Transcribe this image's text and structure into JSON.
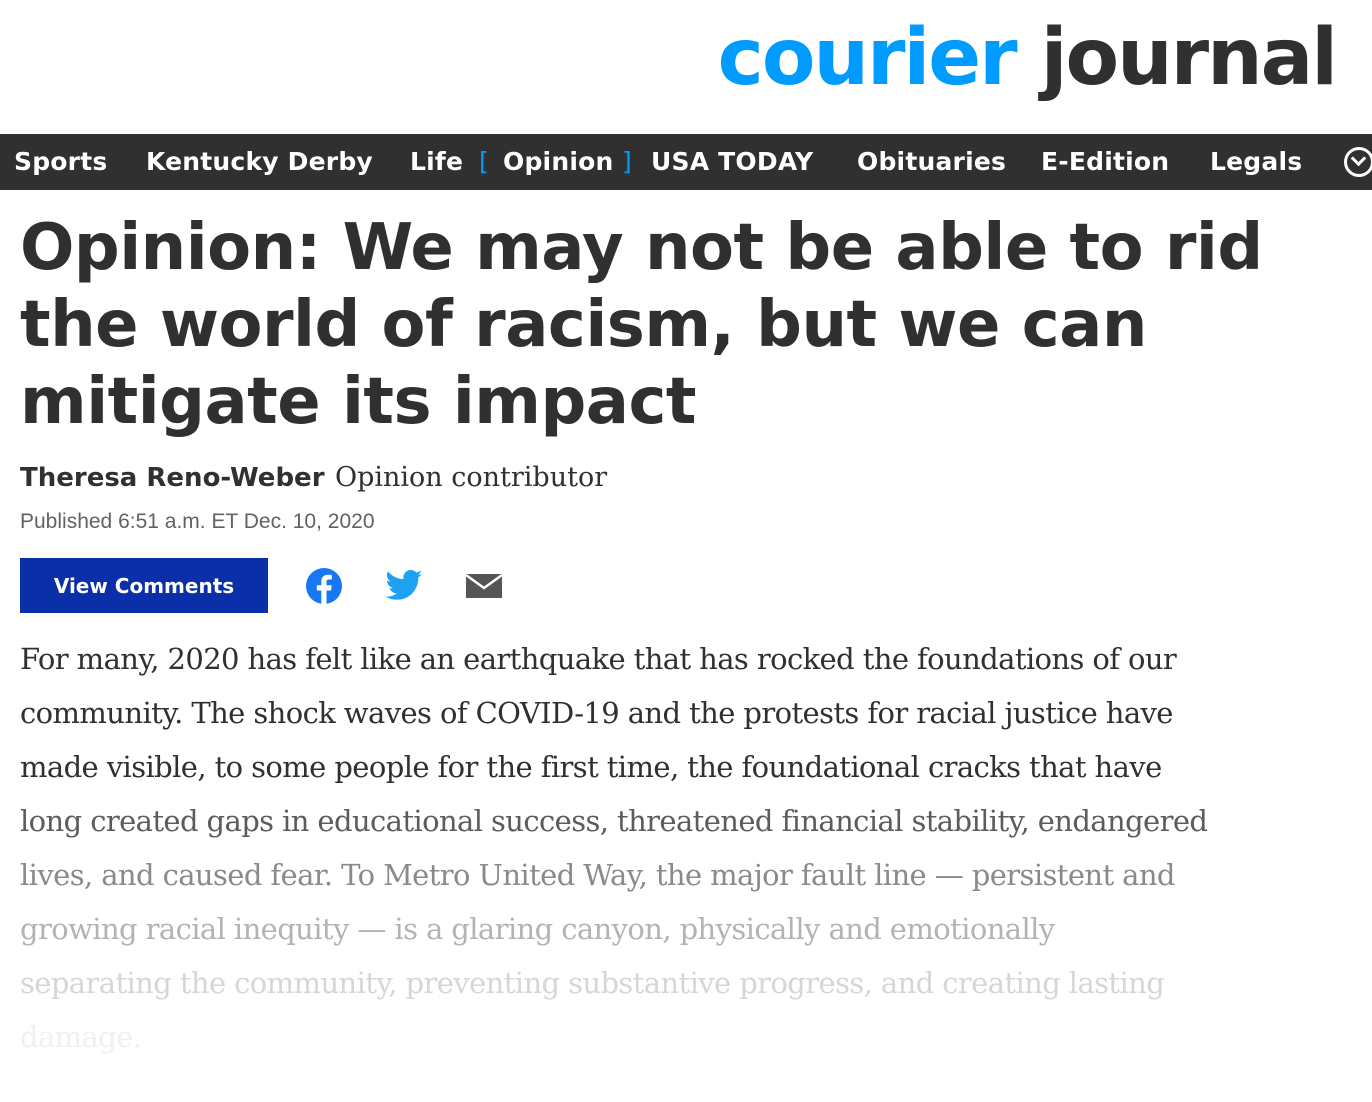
{
  "site": {
    "logo_part1": "courier",
    "logo_part2": "journal"
  },
  "nav": {
    "items": [
      {
        "label": "Sports"
      },
      {
        "label": "Kentucky Derby"
      },
      {
        "label": "Life"
      },
      {
        "label": "Opinion",
        "active": true
      },
      {
        "label": "USA TODAY"
      },
      {
        "label": "Obituaries"
      },
      {
        "label": "E-Edition"
      },
      {
        "label": "Legals"
      }
    ],
    "bracket_open": "[",
    "bracket_close": "]",
    "more_icon": "chevron-down-icon"
  },
  "article": {
    "headline": "Opinion: We may not be able to rid the world of racism, but we can mitigate its impact",
    "author": "Theresa Reno-Weber",
    "author_role": "Opinion contributor",
    "published": "Published 6:51 a.m. ET Dec. 10, 2020",
    "view_comments_label": "View Comments",
    "share_icons": [
      "facebook-icon",
      "twitter-icon",
      "email-icon"
    ],
    "body_lines": [
      "For many, 2020 has felt like an earthquake that has rocked the foundations of our",
      "community. The shock waves of COVID-19 and the protests for racial justice have",
      "made visible, to some people for the first time, the foundational cracks that have",
      "long created gaps in educational success, threatened financial stability, endangered",
      "lives, and caused fear. To Metro United Way, the major fault line — persistent and",
      "growing racial inequity — is a glaring canyon, physically and emotionally",
      "separating the community, preventing substantive progress, and creating lasting",
      "damage."
    ]
  },
  "colors": {
    "brand_blue": "#009bff",
    "nav_bg": "#303030",
    "button_blue": "#0b2fa8",
    "facebook": "#1877f2",
    "twitter": "#1da1f2",
    "email": "#555555"
  }
}
